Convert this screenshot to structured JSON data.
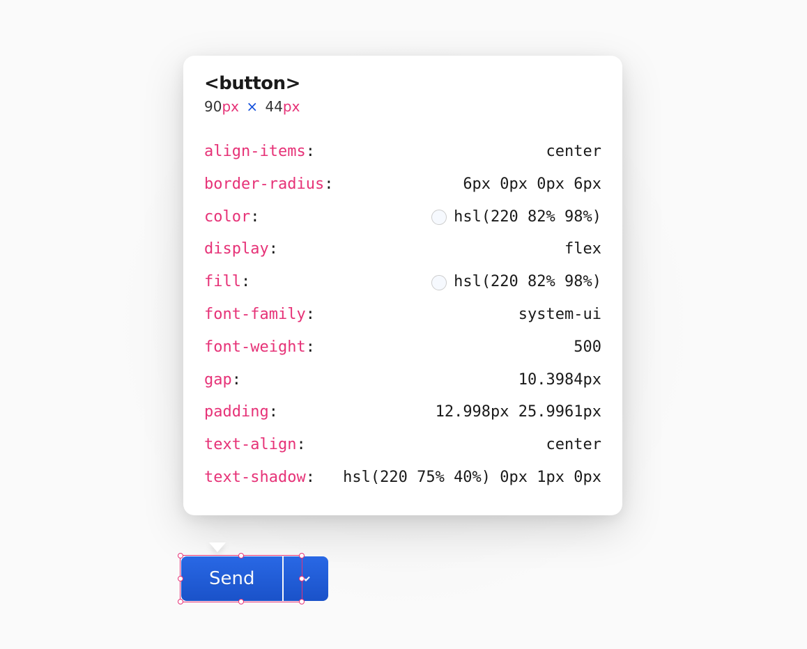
{
  "tooltip": {
    "element_tag": "<button>",
    "dimensions": {
      "width_num": "90",
      "width_unit": "px",
      "times": "×",
      "height_num": "44",
      "height_unit": "px"
    },
    "properties": [
      {
        "name": "align-items",
        "value": "center",
        "has_swatch": false
      },
      {
        "name": "border-radius",
        "value": "6px 0px 0px 6px",
        "has_swatch": false
      },
      {
        "name": "color",
        "value": "hsl(220 82% 98%)",
        "has_swatch": true
      },
      {
        "name": "display",
        "value": "flex",
        "has_swatch": false
      },
      {
        "name": "fill",
        "value": "hsl(220 82% 98%)",
        "has_swatch": true
      },
      {
        "name": "font-family",
        "value": "system-ui",
        "has_swatch": false
      },
      {
        "name": "font-weight",
        "value": "500",
        "has_swatch": false
      },
      {
        "name": "gap",
        "value": "10.3984px",
        "has_swatch": false
      },
      {
        "name": "padding",
        "value": "12.998px 25.9961px",
        "has_swatch": false
      },
      {
        "name": "text-align",
        "value": "center",
        "has_swatch": false
      },
      {
        "name": "text-shadow",
        "value": "hsl(220 75% 40%) 0px 1px 0px",
        "has_swatch": false
      }
    ]
  },
  "buttons": {
    "send_label": "Send"
  }
}
